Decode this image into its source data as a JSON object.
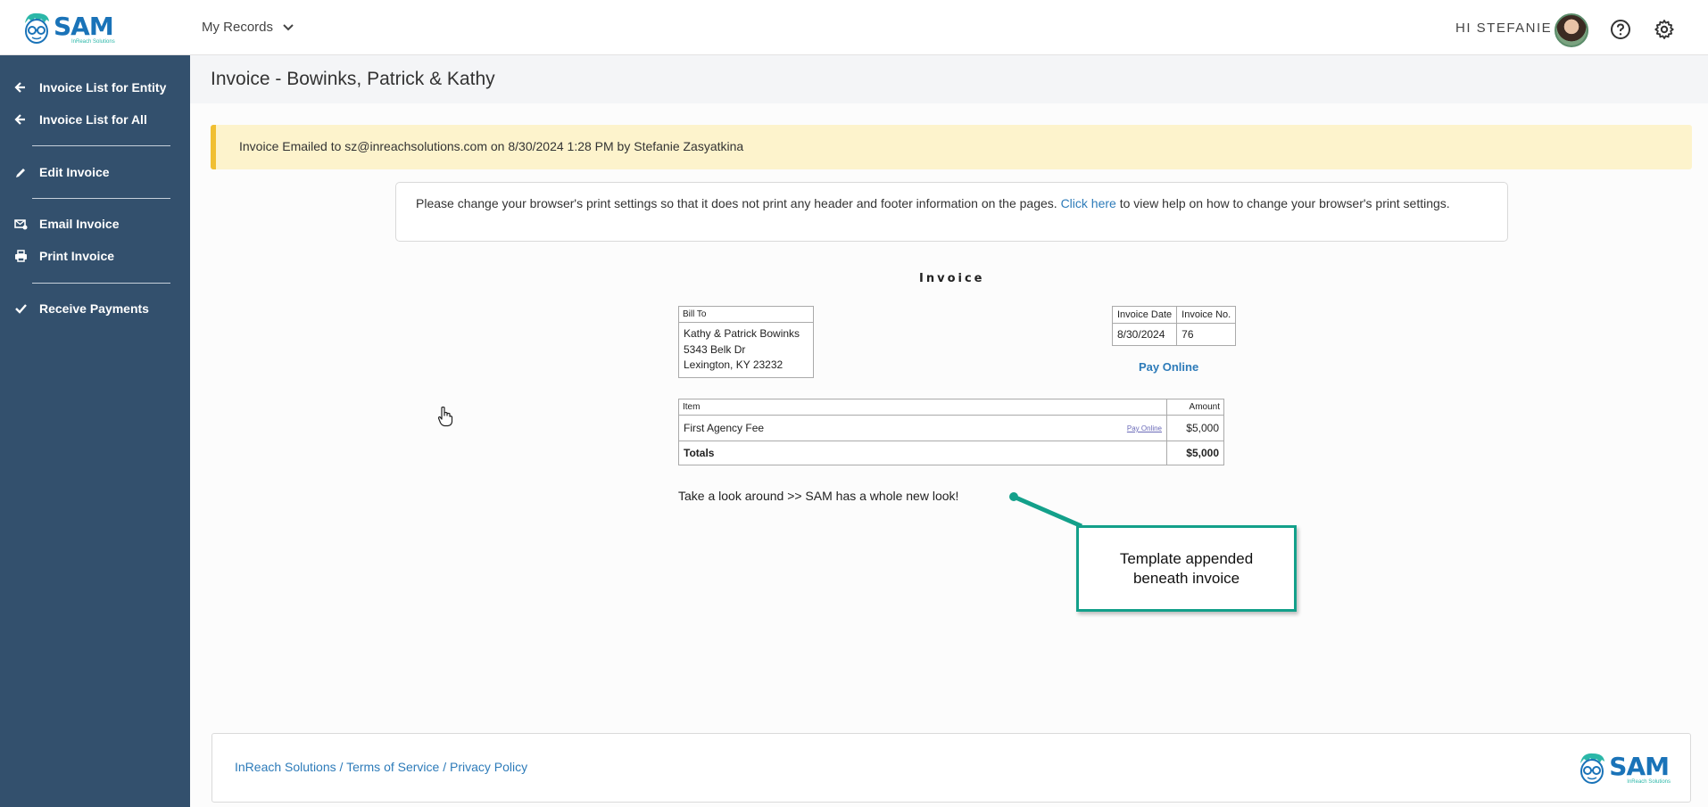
{
  "header": {
    "logo_text": "SAM",
    "logo_subtext": "InReach Solutions",
    "my_records_label": "My Records",
    "greeting": "HI STEFANIE"
  },
  "sidebar": {
    "items": [
      {
        "label": "Invoice List for Entity",
        "icon": "arrow-left-icon"
      },
      {
        "label": "Invoice List for All",
        "icon": "arrow-left-icon"
      },
      {
        "label": "Edit Invoice",
        "icon": "pencil-icon"
      },
      {
        "label": "Email Invoice",
        "icon": "email-icon"
      },
      {
        "label": "Print Invoice",
        "icon": "printer-icon"
      },
      {
        "label": "Receive Payments",
        "icon": "check-icon"
      }
    ]
  },
  "page": {
    "title": "Invoice - Bowinks, Patrick & Kathy",
    "alert": "Invoice Emailed to sz@inreachsolutions.com on 8/30/2024 1:28 PM by Stefanie Zasyatkina",
    "notice_before": "Please change your browser's print settings so that it does not print any header and footer information on the pages.",
    "notice_link": "Click here",
    "notice_after": "to view help on how to change your browser's print settings."
  },
  "invoice": {
    "title": "Invoice",
    "bill_to_label": "Bill To",
    "bill_to_lines": [
      "Kathy & Patrick Bowinks",
      "5343 Belk Dr",
      "Lexington, KY 23232"
    ],
    "date_label": "Invoice Date",
    "number_label": "Invoice No.",
    "date": "8/30/2024",
    "number": "76",
    "pay_online": "Pay Online",
    "item_header": "Item",
    "amount_header": "Amount",
    "line_item": "First Agency Fee",
    "line_link": "Pay Online",
    "line_amount": "$5,000",
    "totals_label": "Totals",
    "totals_amount": "$5,000",
    "template_text": "Take a look around >> SAM has a whole new look!"
  },
  "callout": {
    "text": "Template appended beneath invoice",
    "color": "#13a08a"
  },
  "footer": {
    "link_company": "InReach Solutions",
    "link_terms": "Terms of Service",
    "link_privacy": "Privacy Policy",
    "separator": "/",
    "logo_text": "SAM",
    "logo_subtext": "InReach Solutions"
  }
}
